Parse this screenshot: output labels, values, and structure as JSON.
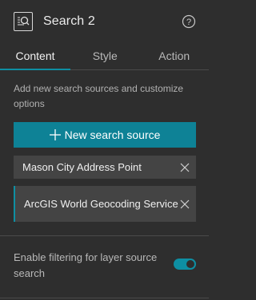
{
  "header": {
    "title": "Search 2",
    "widget_icon": "search-widget-icon",
    "help_icon": "help-icon"
  },
  "tabs": [
    {
      "label": "Content",
      "active": true
    },
    {
      "label": "Style",
      "active": false
    },
    {
      "label": "Action",
      "active": false
    }
  ],
  "content": {
    "description": "Add new search sources and customize options",
    "new_source_label": "New search source",
    "sources": [
      {
        "label": "Mason City Address Point"
      },
      {
        "label": "ArcGIS World Geocoding Service"
      }
    ],
    "filter_label": "Enable filtering for layer source search",
    "filter_enabled": true
  },
  "colors": {
    "background": "#2e2e2e",
    "accent": "#0e8fa3",
    "button": "#0e8296",
    "item": "#444444"
  }
}
